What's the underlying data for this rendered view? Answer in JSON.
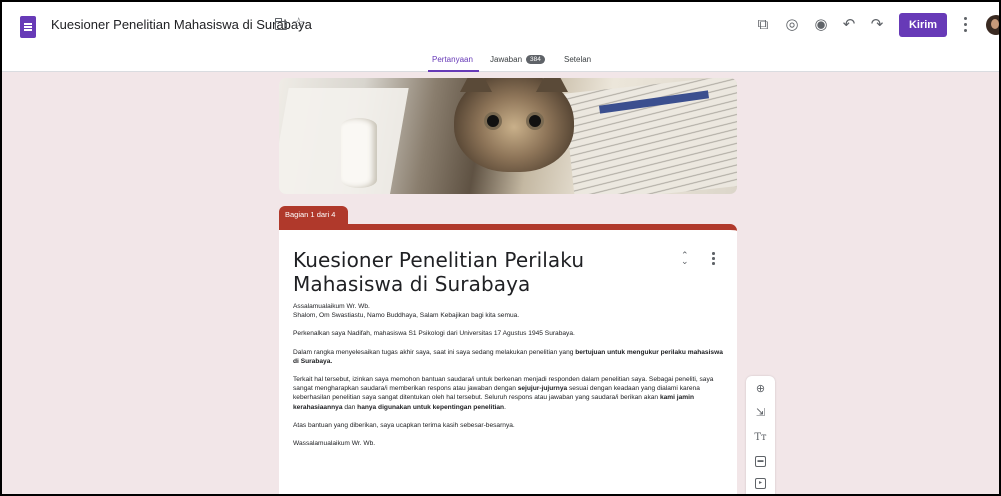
{
  "header": {
    "doc_title": "Kuesioner Penelitian Mahasiswa di Surabaya",
    "send_label": "Kirim",
    "icons": [
      "forms-app-icon",
      "folder-icon",
      "star-icon",
      "addon-icon",
      "palette-icon",
      "preview-icon",
      "undo-icon",
      "redo-icon",
      "more-icon",
      "avatar"
    ]
  },
  "tabs": {
    "questions": "Pertanyaan",
    "responses": "Jawaban",
    "responses_count": "384",
    "settings": "Setelan"
  },
  "section": {
    "label": "Bagian 1 dari 4"
  },
  "form": {
    "title": "Kuesioner Penelitian Perilaku Mahasiswa di Surabaya",
    "greeting": "Assalamualaikum Wr. Wb.",
    "greeting2": "Shalom, Om Swastiastu, Namo Buddhaya, Salam Kebajikan bagi kita semua.",
    "intro": "Perkenalkan saya Nadifah, mahasiswa S1 Psikologi dari Universitas 17 Agustus 1945 Surabaya.",
    "p3_a": "Dalam rangka menyelesaikan tugas akhir saya, saat ini saya sedang melakukan penelitian yang ",
    "p3_b": "bertujuan untuk mengukur perilaku mahasiswa di Surabaya.",
    "p4_a": "Terkait hal tersebut, izinkan saya memohon bantuan saudara/i untuk berkenan menjadi responden dalam penelitian saya. Sebagai peneliti, saya sangat mengharapkan saudara/i memberikan respons atau jawaban dengan ",
    "p4_b": "sejujur-jujurnya",
    "p4_c": " sesuai dengan keadaan yang dialami karena keberhasilan penelitian saya sangat ditentukan oleh hal tersebut. Seluruh respons atau jawaban yang saudara/i berikan akan ",
    "p4_d": "kami jamin kerahasiaannya",
    "p4_e": " dan ",
    "p4_f": "hanya digunakan untuk kepentingan penelitian",
    "p4_g": ".",
    "thanks": "Atas bantuan yang diberikan, saya ucapkan terima kasih sebesar-besarnya.",
    "closing": "Wassalamualaikum Wr. Wb."
  },
  "colors": {
    "accent": "#673ab7",
    "theme": "#b0392b",
    "background": "#f2e6e8"
  }
}
